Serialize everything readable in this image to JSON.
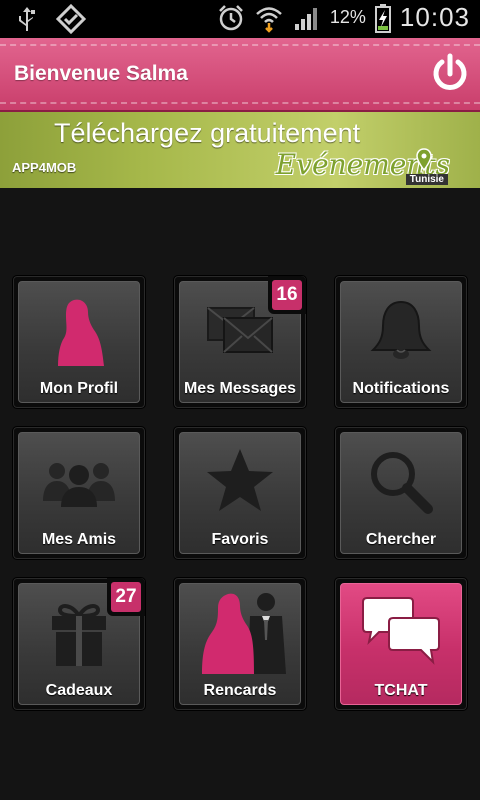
{
  "status_bar": {
    "battery_percent": "12%",
    "time": "10:03",
    "icons": [
      "usb-icon",
      "app-icon",
      "alarm-icon",
      "wifi-icon",
      "signal-icon",
      "battery-charging-icon"
    ]
  },
  "header": {
    "title": "Bienvenue Salma",
    "power_icon": "power-icon",
    "accent": "#d24b7a"
  },
  "banner": {
    "headline": "Téléchargez gratuitement",
    "brand": "APP4MOB",
    "product": "Evénements",
    "country": "Tunisie"
  },
  "menu": {
    "profile": {
      "label": "Mon Profil",
      "icon": "woman-silhouette-icon"
    },
    "messages": {
      "label": "Mes Messages",
      "icon": "envelopes-icon",
      "badge": "16"
    },
    "notifications": {
      "label": "Notifications",
      "icon": "bell-icon"
    },
    "friends": {
      "label": "Mes Amis",
      "icon": "group-icon"
    },
    "favorites": {
      "label": "Favoris",
      "icon": "star-icon"
    },
    "search": {
      "label": "Chercher",
      "icon": "magnifier-icon"
    },
    "gifts": {
      "label": "Cadeaux",
      "icon": "gift-icon",
      "badge": "27"
    },
    "dates": {
      "label": "Rencards",
      "icon": "couple-icon"
    },
    "chat": {
      "label": "TCHAT",
      "icon": "chat-bubbles-icon",
      "color": "#c7306a"
    }
  }
}
